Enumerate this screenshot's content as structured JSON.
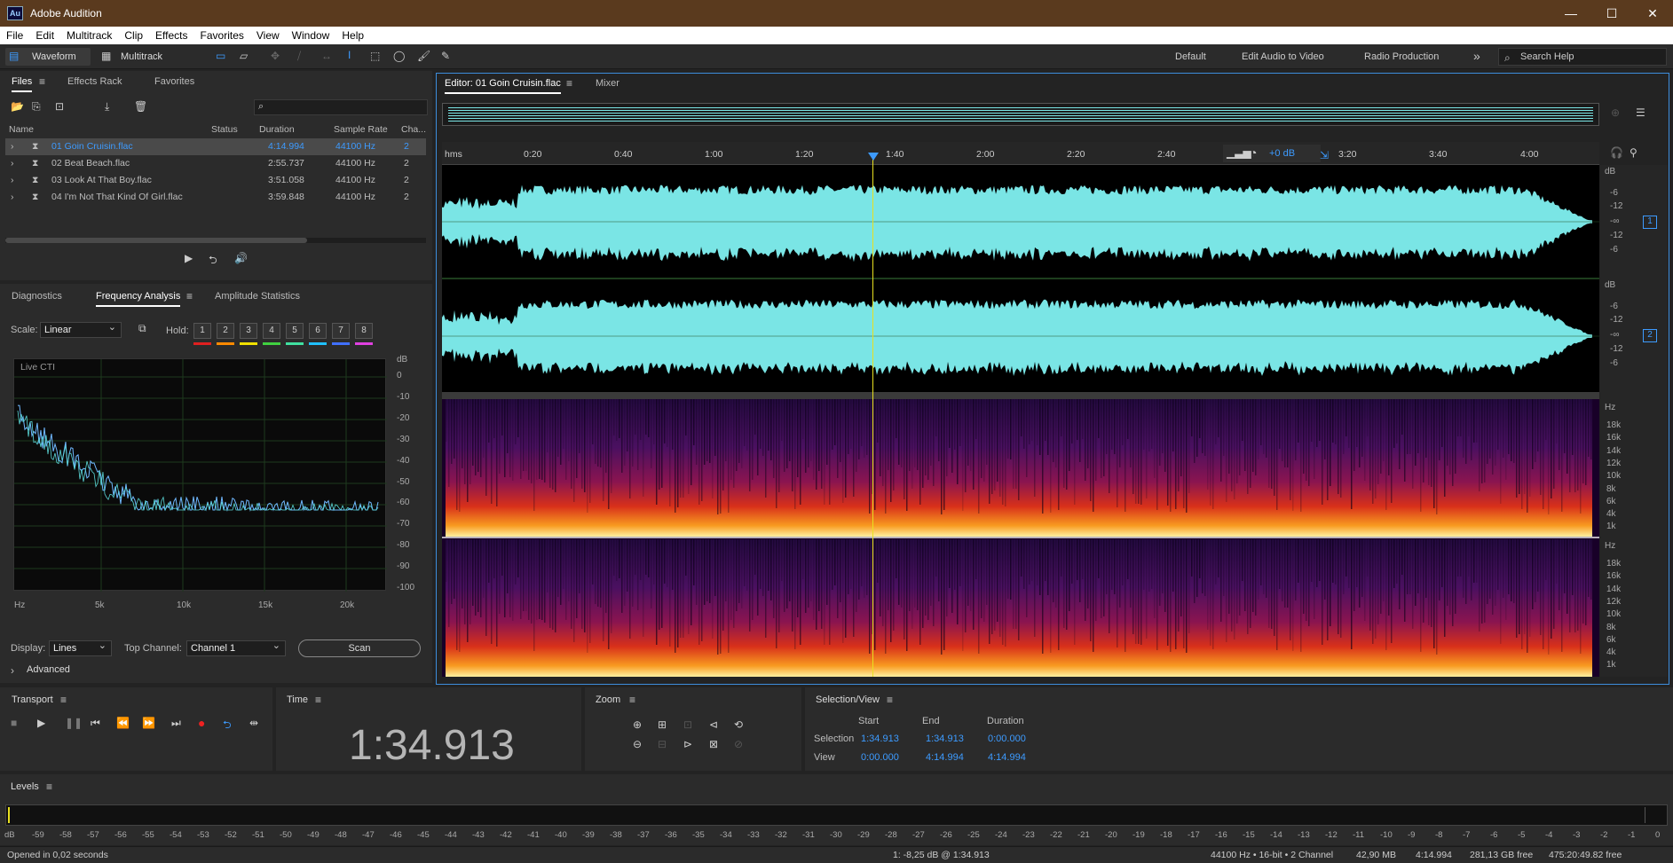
{
  "app": {
    "title": "Adobe Audition",
    "logo": "Au"
  },
  "window_controls": {
    "minimize": "—",
    "maximize": "☐",
    "close": "✕"
  },
  "menu": [
    "File",
    "Edit",
    "Multitrack",
    "Clip",
    "Effects",
    "Favorites",
    "View",
    "Window",
    "Help"
  ],
  "toolbar": {
    "waveform_label": "Waveform",
    "multitrack_label": "Multitrack",
    "workspaces": [
      "Default",
      "Edit Audio to Video",
      "Radio Production"
    ],
    "more": "»",
    "search_placeholder": "Search Help"
  },
  "files_panel": {
    "tabs": [
      "Files",
      "Effects Rack",
      "Favorites"
    ],
    "columns": [
      "Name",
      "Status",
      "Duration",
      "Sample Rate",
      "Cha..."
    ],
    "files": [
      {
        "name": "01 Goin Cruisin.flac",
        "duration": "4:14.994",
        "rate": "44100 Hz",
        "channels": "2"
      },
      {
        "name": "02 Beat Beach.flac",
        "duration": "2:55.737",
        "rate": "44100 Hz",
        "channels": "2"
      },
      {
        "name": "03 Look At That Boy.flac",
        "duration": "3:51.058",
        "rate": "44100 Hz",
        "channels": "2"
      },
      {
        "name": "04 I'm Not That Kind Of Girl.flac",
        "duration": "3:59.848",
        "rate": "44100 Hz",
        "channels": "2"
      }
    ]
  },
  "analysis_panel": {
    "tabs": [
      "Diagnostics",
      "Frequency Analysis",
      "Amplitude Statistics"
    ],
    "scale_label": "Scale:",
    "scale_value": "Linear",
    "hold_label": "Hold:",
    "holds": [
      "1",
      "2",
      "3",
      "4",
      "5",
      "6",
      "7",
      "8"
    ],
    "hold_colors": [
      "#e02020",
      "#ff8a00",
      "#f0e000",
      "#40d040",
      "#40e0a0",
      "#20c0ff",
      "#4070ff",
      "#e040e0"
    ],
    "live_label": "Live CTI",
    "db_unit": "dB",
    "db_ticks": [
      "0",
      "-10",
      "-20",
      "-30",
      "-40",
      "-50",
      "-60",
      "-70",
      "-80",
      "-90",
      "-100"
    ],
    "hz_ticks": [
      "Hz",
      "5k",
      "10k",
      "15k",
      "20k"
    ],
    "display_label": "Display:",
    "display_value": "Lines",
    "top_channel_label": "Top Channel:",
    "top_channel_value": "Channel 1",
    "scan_label": "Scan",
    "advanced_label": "Advanced"
  },
  "editor": {
    "tab_label": "Editor: 01 Goin Cruisin.flac",
    "mixer_label": "Mixer",
    "ruler_unit": "hms",
    "ruler_ticks": [
      "0:20",
      "0:40",
      "1:00",
      "1:20",
      "1:40",
      "2:00",
      "2:20",
      "2:40",
      "3:20",
      "3:40",
      "4:00"
    ],
    "gain_label": "+0 dB",
    "db_unit": "dB",
    "db_ticks": [
      "-6",
      "-12",
      "-∞",
      "-12",
      "-6"
    ],
    "channel_badges": [
      "1",
      "2"
    ],
    "hz_unit": "Hz",
    "hz_ticks": [
      "18k",
      "16k",
      "14k",
      "12k",
      "10k",
      "8k",
      "6k",
      "4k",
      "1k"
    ]
  },
  "transport": {
    "title": "Transport"
  },
  "time": {
    "title": "Time",
    "value": "1:34.913"
  },
  "zoom": {
    "title": "Zoom"
  },
  "selection": {
    "title": "Selection/View",
    "headers": [
      "Start",
      "End",
      "Duration"
    ],
    "rows": [
      {
        "label": "Selection",
        "start": "1:34.913",
        "end": "1:34.913",
        "duration": "0:00.000"
      },
      {
        "label": "View",
        "start": "0:00.000",
        "end": "4:14.994",
        "duration": "4:14.994"
      }
    ]
  },
  "levels": {
    "title": "Levels",
    "ticks": [
      "dB",
      "-59",
      "-58",
      "-57",
      "-56",
      "-55",
      "-54",
      "-53",
      "-52",
      "-51",
      "-50",
      "-49",
      "-48",
      "-47",
      "-46",
      "-45",
      "-44",
      "-43",
      "-42",
      "-41",
      "-40",
      "-39",
      "-38",
      "-37",
      "-36",
      "-35",
      "-34",
      "-33",
      "-32",
      "-31",
      "-30",
      "-29",
      "-28",
      "-27",
      "-26",
      "-25",
      "-24",
      "-23",
      "-22",
      "-21",
      "-20",
      "-19",
      "-18",
      "-17",
      "-16",
      "-15",
      "-14",
      "-13",
      "-12",
      "-11",
      "-10",
      "-9",
      "-8",
      "-7",
      "-6",
      "-5",
      "-4",
      "-3",
      "-2",
      "-1",
      "0"
    ]
  },
  "status": {
    "left": "Opened in 0,02 seconds",
    "cursor": "1: -8,25 dB @ 1:34.913",
    "format": "44100 Hz • 16-bit • 2 Channel",
    "size": "42,90 MB",
    "duration": "4:14.994",
    "free": "281,13 GB free",
    "time_free": "475:20:49.82 free"
  },
  "colors": {
    "accent": "#3d9bff",
    "waveform": "#7ae5e5",
    "titlebar": "#5a3a1e",
    "playhead": "#e8e020"
  }
}
